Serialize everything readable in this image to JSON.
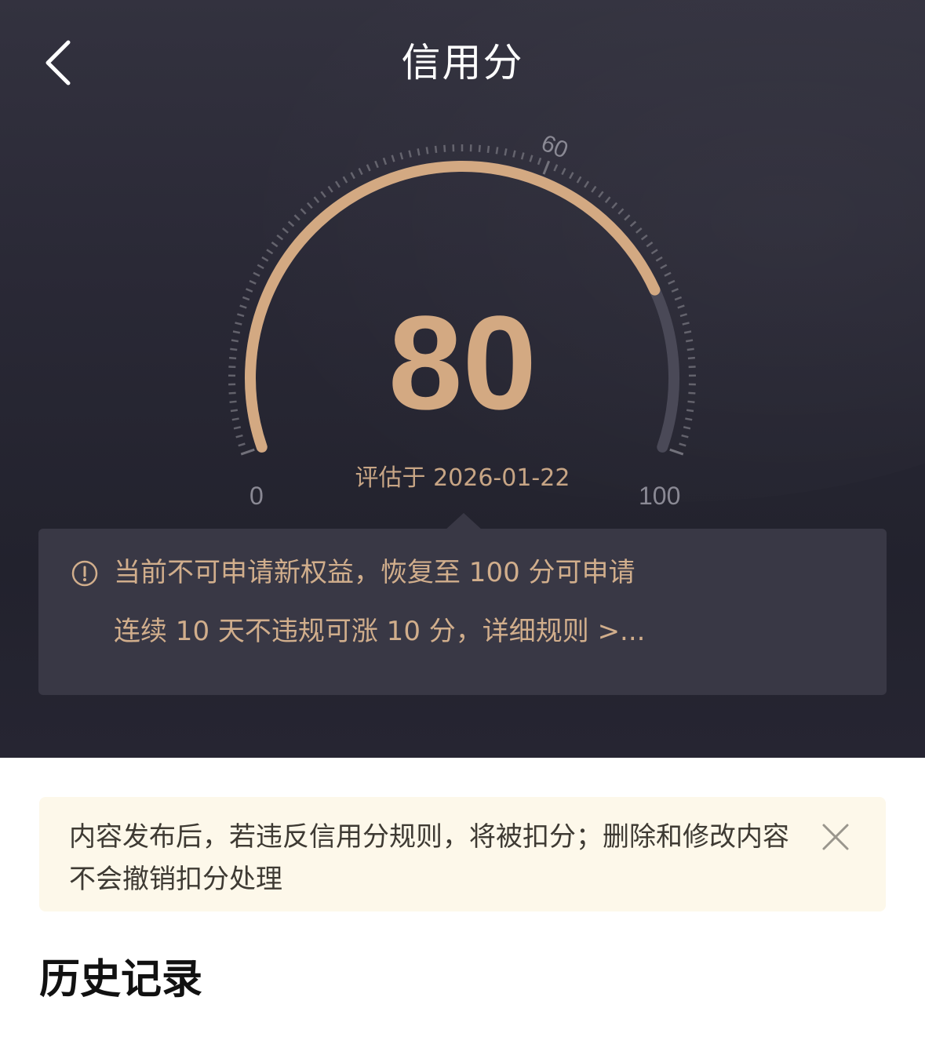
{
  "header": {
    "title": "信用分",
    "back_icon": "chevron-left-icon"
  },
  "gauge": {
    "score": "80",
    "score_value": 80,
    "min_label": "0",
    "max_label": "100",
    "marker_label": "60",
    "min": 0,
    "max": 100,
    "marker_value": 60,
    "evaluated_text": "评估于 2026-01-22",
    "colors": {
      "progress": "#d3a982",
      "track": "#4a4957",
      "ticks": "#77767f"
    }
  },
  "notice": {
    "icon": "info-circle-icon",
    "line1": "当前不可申请新权益，恢复至 100 分可申请",
    "line2": "连续 10 天不违规可涨 10 分，详细规则 >..."
  },
  "tip": {
    "text": "内容发布后，若违反信用分规则，将被扣分；删除和修改内容不会撤销扣分处理",
    "close_icon": "close-icon"
  },
  "history": {
    "title": "历史记录"
  }
}
